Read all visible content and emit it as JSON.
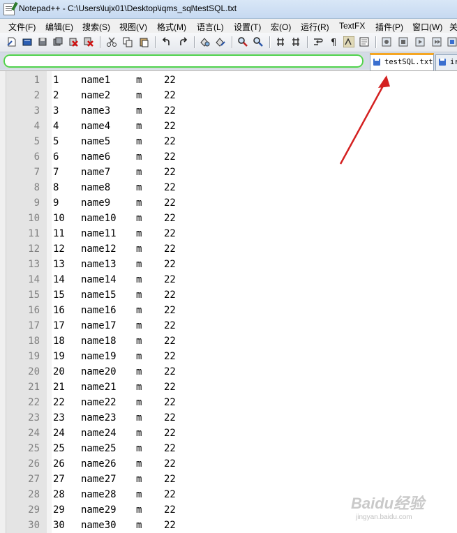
{
  "window": {
    "title": "Notepad++ - C:\\Users\\lujx01\\Desktop\\iqms_sql\\testSQL.txt"
  },
  "menu": [
    {
      "label": "文件(F)"
    },
    {
      "label": "编辑(E)"
    },
    {
      "label": "搜索(S)"
    },
    {
      "label": "视图(V)"
    },
    {
      "label": "格式(M)"
    },
    {
      "label": "语言(L)"
    },
    {
      "label": "设置(T)"
    },
    {
      "label": "宏(O)"
    },
    {
      "label": "运行(R)"
    },
    {
      "label": "TextFX"
    },
    {
      "label": "插件(P)"
    },
    {
      "label": "窗口(W)"
    },
    {
      "label": "关"
    }
  ],
  "toolbar": {
    "icons": [
      "new-file-icon",
      "open-file-icon",
      "save-icon",
      "save-all-icon",
      "close-icon",
      "close-all-icon",
      "cut-icon",
      "copy-icon",
      "paste-icon",
      "undo-icon",
      "redo-icon",
      "find-icon",
      "replace-icon",
      "zoom-in-icon",
      "zoom-out-icon",
      "sync-vertical-icon",
      "sync-horizontal-icon",
      "word-wrap-icon",
      "show-all-chars-icon",
      "indent-guide-icon",
      "document-map-icon",
      "record-macro-icon",
      "stop-macro-icon",
      "play-macro-icon",
      "run-macro-icon",
      "save-macro-icon"
    ]
  },
  "tabs": [
    {
      "label": "testSQL.txt",
      "active": true
    },
    {
      "label": "ir",
      "active": false
    }
  ],
  "colors": {
    "find_highlight": "#4fd24f",
    "active_tab_accent": "#f5a623",
    "arrow": "#d42020"
  },
  "editor": {
    "lines": [
      {
        "num": "1",
        "id": "1",
        "name": "name1",
        "sex": "m",
        "age": "22"
      },
      {
        "num": "2",
        "id": "2",
        "name": "name2",
        "sex": "m",
        "age": "22"
      },
      {
        "num": "3",
        "id": "3",
        "name": "name3",
        "sex": "m",
        "age": "22"
      },
      {
        "num": "4",
        "id": "4",
        "name": "name4",
        "sex": "m",
        "age": "22"
      },
      {
        "num": "5",
        "id": "5",
        "name": "name5",
        "sex": "m",
        "age": "22"
      },
      {
        "num": "6",
        "id": "6",
        "name": "name6",
        "sex": "m",
        "age": "22"
      },
      {
        "num": "7",
        "id": "7",
        "name": "name7",
        "sex": "m",
        "age": "22"
      },
      {
        "num": "8",
        "id": "8",
        "name": "name8",
        "sex": "m",
        "age": "22"
      },
      {
        "num": "9",
        "id": "9",
        "name": "name9",
        "sex": "m",
        "age": "22"
      },
      {
        "num": "10",
        "id": "10",
        "name": "name10",
        "sex": "m",
        "age": "22"
      },
      {
        "num": "11",
        "id": "11",
        "name": "name11",
        "sex": "m",
        "age": "22"
      },
      {
        "num": "12",
        "id": "12",
        "name": "name12",
        "sex": "m",
        "age": "22"
      },
      {
        "num": "13",
        "id": "13",
        "name": "name13",
        "sex": "m",
        "age": "22"
      },
      {
        "num": "14",
        "id": "14",
        "name": "name14",
        "sex": "m",
        "age": "22"
      },
      {
        "num": "15",
        "id": "15",
        "name": "name15",
        "sex": "m",
        "age": "22"
      },
      {
        "num": "16",
        "id": "16",
        "name": "name16",
        "sex": "m",
        "age": "22"
      },
      {
        "num": "17",
        "id": "17",
        "name": "name17",
        "sex": "m",
        "age": "22"
      },
      {
        "num": "18",
        "id": "18",
        "name": "name18",
        "sex": "m",
        "age": "22"
      },
      {
        "num": "19",
        "id": "19",
        "name": "name19",
        "sex": "m",
        "age": "22"
      },
      {
        "num": "20",
        "id": "20",
        "name": "name20",
        "sex": "m",
        "age": "22"
      },
      {
        "num": "21",
        "id": "21",
        "name": "name21",
        "sex": "m",
        "age": "22"
      },
      {
        "num": "22",
        "id": "22",
        "name": "name22",
        "sex": "m",
        "age": "22"
      },
      {
        "num": "23",
        "id": "23",
        "name": "name23",
        "sex": "m",
        "age": "22"
      },
      {
        "num": "24",
        "id": "24",
        "name": "name24",
        "sex": "m",
        "age": "22"
      },
      {
        "num": "25",
        "id": "25",
        "name": "name25",
        "sex": "m",
        "age": "22"
      },
      {
        "num": "26",
        "id": "26",
        "name": "name26",
        "sex": "m",
        "age": "22"
      },
      {
        "num": "27",
        "id": "27",
        "name": "name27",
        "sex": "m",
        "age": "22"
      },
      {
        "num": "28",
        "id": "28",
        "name": "name28",
        "sex": "m",
        "age": "22"
      },
      {
        "num": "29",
        "id": "29",
        "name": "name29",
        "sex": "m",
        "age": "22"
      },
      {
        "num": "30",
        "id": "30",
        "name": "name30",
        "sex": "m",
        "age": "22"
      }
    ]
  },
  "watermark": {
    "logo": "Baidu经验",
    "url": "jingyan.baidu.com"
  }
}
